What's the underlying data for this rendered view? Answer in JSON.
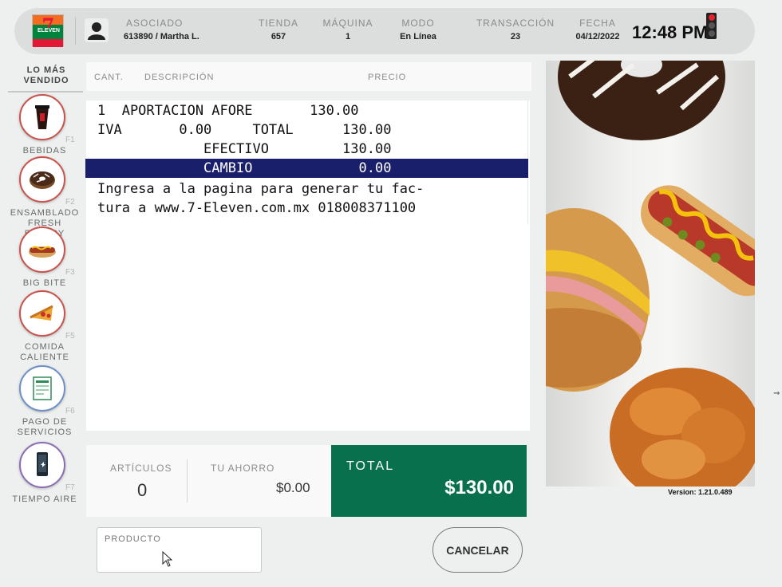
{
  "header": {
    "logo": {
      "number": "7",
      "text": "ELEVEN"
    },
    "asociado": {
      "label": "ASOCIADO",
      "value": "613890 / Martha L."
    },
    "tienda": {
      "label": "TIENDA",
      "value": "657"
    },
    "maquina": {
      "label": "MÁQUINA",
      "value": "1"
    },
    "modo": {
      "label": "MODO",
      "value": "En Línea"
    },
    "transaccion": {
      "label": "TRANSACCIÓN",
      "value": "23"
    },
    "fecha": {
      "label": "FECHA",
      "value": "04/12/2022"
    },
    "clock": "12:48 PM"
  },
  "sidebar": {
    "title": "LO MÁS VENDIDO",
    "items": [
      {
        "label": "BEBIDAS",
        "fkey": "F1",
        "icon": "drink-cup-icon"
      },
      {
        "label": "ENSAMBLADO FRESH BAKERY",
        "fkey": "F2",
        "icon": "donut-icon"
      },
      {
        "label": "BIG BITE",
        "fkey": "F3",
        "icon": "hotdog-icon"
      },
      {
        "label": "COMIDA CALIENTE",
        "fkey": "F5",
        "icon": "pizza-icon"
      },
      {
        "label": "PAGO DE SERVICIOS",
        "fkey": "F6",
        "icon": "receipt-icon"
      },
      {
        "label": "TIEMPO AIRE",
        "fkey": "F7",
        "icon": "phone-icon"
      }
    ]
  },
  "ticket": {
    "headers": {
      "qty": "CANT.",
      "desc": "DESCRIPCIÓN",
      "price": "PRECIO"
    },
    "lines": [
      "1  APORTACION AFORE       130.00",
      "IVA       0.00     TOTAL      130.00",
      "             EFECTIVO         130.00",
      "             CAMBIO             0.00",
      "Ingresa a la pagina para generar tu fac-",
      "tura a www.7-Eleven.com.mx 018008371100"
    ],
    "highlight_index": 3
  },
  "totals": {
    "articulos_label": "ARTÍCULOS",
    "articulos_value": "0",
    "ahorro_label": "TU AHORRO",
    "ahorro_value": "$0.00",
    "total_label": "TOTAL",
    "total_value": "$130.00"
  },
  "product": {
    "label": "PRODUCTO",
    "value": ""
  },
  "cancel_label": "CANCELAR",
  "version": "Version: 1.21.0.489",
  "colors": {
    "total_bg": "#09704e",
    "highlight": "#1a1f6b",
    "brand_green": "#00843d",
    "brand_orange": "#f26c22",
    "brand_red": "#e31837"
  }
}
